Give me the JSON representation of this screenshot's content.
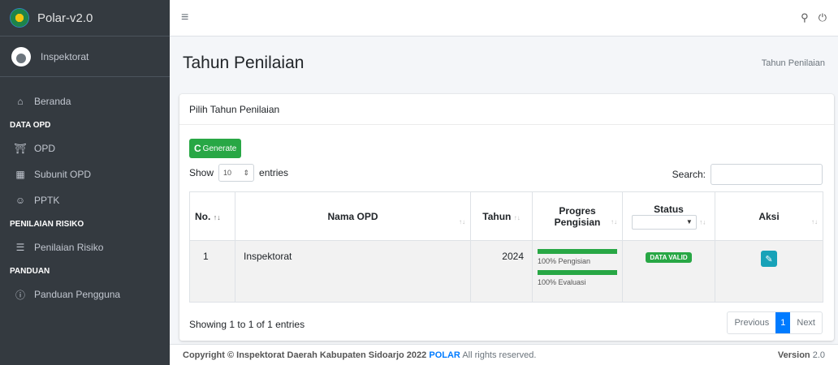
{
  "brand": {
    "title": "Polar-v2.0"
  },
  "user": {
    "name": "Inspektorat"
  },
  "sidebar": {
    "items": [
      {
        "type": "item",
        "label": "Beranda",
        "icon": "home-icon"
      },
      {
        "type": "header",
        "label": "DATA OPD"
      },
      {
        "type": "item",
        "label": "OPD",
        "icon": "building-icon"
      },
      {
        "type": "item",
        "label": "Subunit OPD",
        "icon": "list-icon"
      },
      {
        "type": "item",
        "label": "PPTK",
        "icon": "users-icon"
      },
      {
        "type": "header",
        "label": "PENILAIAN RISIKO"
      },
      {
        "type": "item",
        "label": "Penilaian Risiko",
        "icon": "task-list-icon"
      },
      {
        "type": "header",
        "label": "PANDUAN"
      },
      {
        "type": "item",
        "label": "Panduan Pengguna",
        "icon": "question-icon"
      }
    ]
  },
  "page": {
    "title": "Tahun Penilaian",
    "breadcrumb": "Tahun Penilaian"
  },
  "card": {
    "header": "Pilih Tahun Penilaian",
    "generate_label": "Generate",
    "show_label": "Show",
    "entries_label": "entries",
    "entries_value": "10",
    "search_label": "Search:",
    "search_value": ""
  },
  "table": {
    "columns": [
      "No.",
      "Nama OPD",
      "Tahun",
      "Progres Pengisian",
      "Status",
      "Aksi"
    ],
    "rows": [
      {
        "no": "1",
        "nama": "Inspektorat",
        "tahun": "2024",
        "pengisian_label": "100% Pengisian",
        "pengisian_value": 100,
        "evaluasi_label": "100% Evaluasi",
        "evaluasi_value": 100,
        "status": "DATA VALID"
      }
    ]
  },
  "footer_table": {
    "showing": "Showing 1 to 1 of 1 entries",
    "prev": "Previous",
    "page": "1",
    "next": "Next"
  },
  "footer": {
    "copyright": "Copyright © Inspektorat Daerah Kabupaten Sidoarjo 2022",
    "brand": "POLAR",
    "rights": "All rights reserved.",
    "version_label": "Version",
    "version_value": "2.0"
  },
  "colors": {
    "sidebar": "#343a40",
    "accent_green": "#28a745",
    "accent_blue": "#007bff",
    "edit_button": "#17a2b8"
  }
}
